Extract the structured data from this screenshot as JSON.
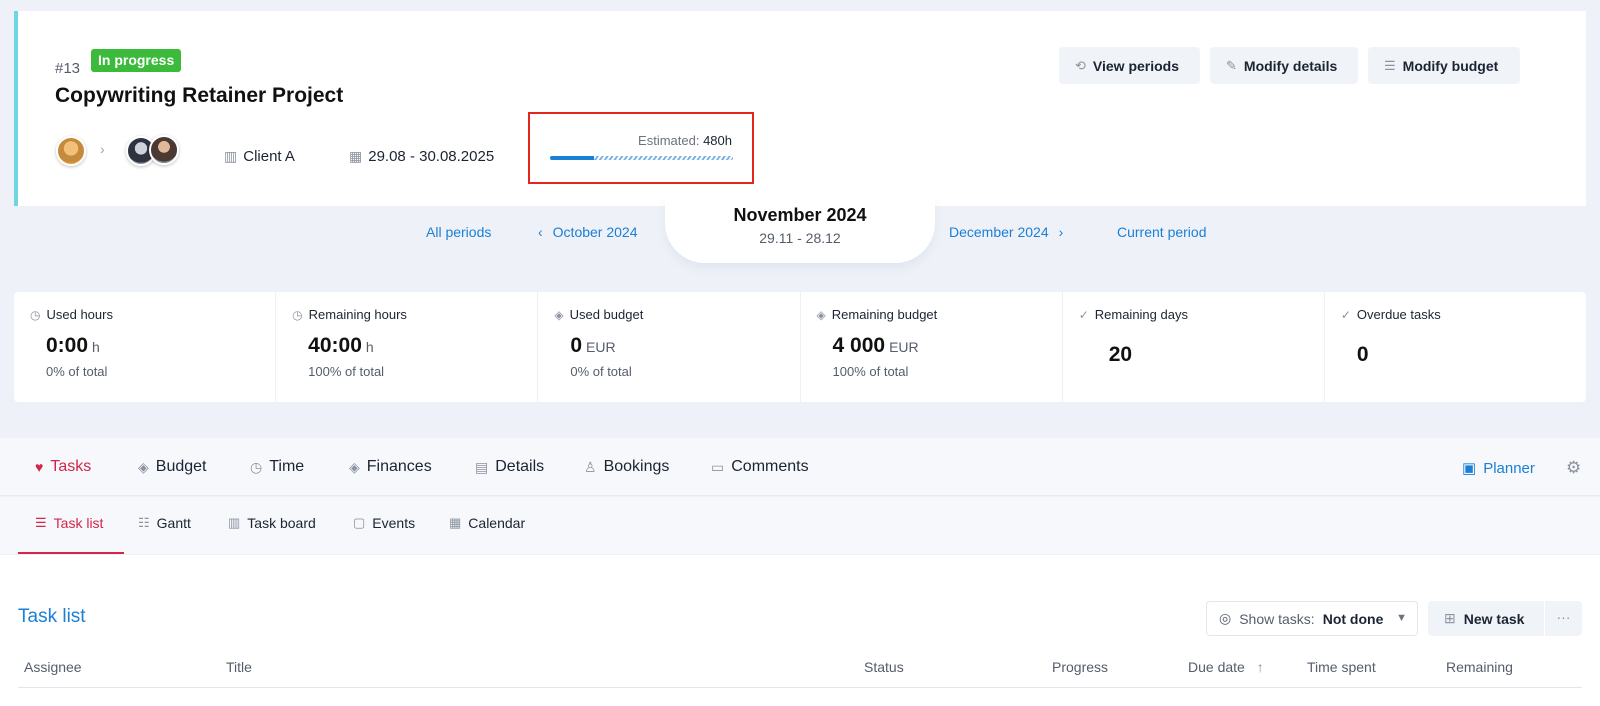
{
  "project": {
    "number": "#13",
    "status": "In progress",
    "title": "Copywriting Retainer Project",
    "client": "Client A",
    "dates": "29.08 - 30.08.2025",
    "estimated_label": "Estimated:",
    "estimated_value": "480h",
    "estimated_progress": 0.24
  },
  "header_buttons": {
    "view_periods": "View periods",
    "modify_details": "Modify details",
    "modify_budget": "Modify budget"
  },
  "periods": {
    "all": "All periods",
    "prev": "October 2024",
    "current_title": "November 2024",
    "current_range": "29.11 - 28.12",
    "next": "December 2024",
    "current_link": "Current period"
  },
  "stats": [
    {
      "label": "Used hours",
      "value": "0:00",
      "unit": "h",
      "sub": "0% of total"
    },
    {
      "label": "Remaining hours",
      "value": "40:00",
      "unit": "h",
      "sub": "100% of total"
    },
    {
      "label": "Used budget",
      "value": "0",
      "unit": "EUR",
      "sub": "0% of total"
    },
    {
      "label": "Remaining budget",
      "value": "4 000",
      "unit": "EUR",
      "sub": "100% of total"
    },
    {
      "label": "Remaining days",
      "value": "20"
    },
    {
      "label": "Overdue tasks",
      "value": "0"
    }
  ],
  "main_tabs": [
    "Tasks",
    "Budget",
    "Time",
    "Finances",
    "Details",
    "Bookings",
    "Comments"
  ],
  "planner": "Planner",
  "sub_tabs": [
    "Task list",
    "Gantt",
    "Task board",
    "Events",
    "Calendar"
  ],
  "task_list": {
    "title": "Task list",
    "show_tasks_label": "Show tasks:",
    "show_tasks_value": "Not done",
    "new_task": "New task",
    "more": "···",
    "columns": [
      "Assignee",
      "Title",
      "Status",
      "Progress",
      "Due date",
      "Time spent",
      "Remaining"
    ]
  },
  "colors": {
    "accent": "#1a7fd6",
    "active_tab": "#d3264a",
    "status_green": "#3cba3c",
    "highlight_red": "#e5261f"
  }
}
